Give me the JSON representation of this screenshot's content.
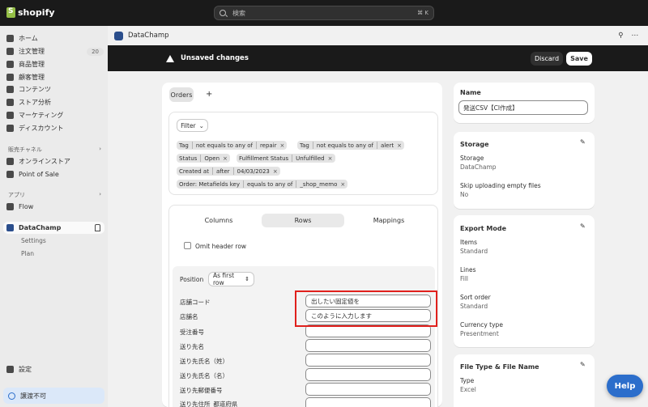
{
  "topbar": {
    "brand": "shopify",
    "search_placeholder": "検索",
    "search_shortcut": "⌘ K"
  },
  "sidebar": {
    "items": [
      {
        "label": "ホーム",
        "icon": "home-icon"
      },
      {
        "label": "注文管理",
        "icon": "orders-icon",
        "badge": "20"
      },
      {
        "label": "商品管理",
        "icon": "tag-icon"
      },
      {
        "label": "顧客管理",
        "icon": "person-icon"
      },
      {
        "label": "コンテンツ",
        "icon": "content-icon"
      },
      {
        "label": "ストア分析",
        "icon": "chart-icon"
      },
      {
        "label": "マーケティング",
        "icon": "target-icon"
      },
      {
        "label": "ディスカウント",
        "icon": "discount-icon"
      }
    ],
    "sales_channels_heading": "販売チャネル",
    "channels": [
      {
        "label": "オンラインストア",
        "icon": "store-icon"
      },
      {
        "label": "Point of Sale",
        "icon": "pos-icon"
      }
    ],
    "apps_heading": "アプリ",
    "apps": [
      {
        "label": "Flow",
        "icon": "flow-icon"
      }
    ],
    "active_app": "DataChamp",
    "sub_items": [
      "Settings",
      "Plan"
    ],
    "settings_label": "設定",
    "notice": "譲渡不可"
  },
  "appbar": {
    "title": "DataChamp"
  },
  "unsaved": {
    "message": "Unsaved changes",
    "discard": "Discard",
    "save": "Save"
  },
  "main": {
    "tab": "Orders",
    "add_tab": "+",
    "filter_label": "Filter",
    "chips": [
      [
        "Tag",
        "not equals to any of",
        "repair"
      ],
      [
        "Tag",
        "not equals to any of",
        "alert"
      ],
      [
        "Status",
        "Open"
      ],
      [
        "Fulfillment Status",
        "Unfulfilled"
      ],
      [
        "Created at",
        "after",
        "04/03/2023"
      ],
      [
        "Order: Metafields key",
        "equals to any of",
        "_shop_memo"
      ]
    ],
    "subtabs": [
      "Columns",
      "Rows",
      "Mappings"
    ],
    "omit_header": "Omit header row",
    "position_label": "Position",
    "position_value": "As first row",
    "fields": [
      {
        "label": "店舗コード",
        "value": "出したい固定値を"
      },
      {
        "label": "店舗名",
        "value": "このように入力します"
      },
      {
        "label": "受注番号",
        "value": ""
      },
      {
        "label": "送り先名",
        "value": ""
      },
      {
        "label": "送り先氏名（姓）",
        "value": ""
      },
      {
        "label": "送り先氏名（名）",
        "value": ""
      },
      {
        "label": "送り先郵便番号",
        "value": ""
      },
      {
        "label": "送り先住所_都道府県",
        "value": ""
      }
    ]
  },
  "right": {
    "name_title": "Name",
    "name_value": "発送CSV【CI作成】",
    "storage_title": "Storage",
    "storage_label": "Storage",
    "storage_value": "DataChamp",
    "skip_label": "Skip uploading empty files",
    "skip_value": "No",
    "export_title": "Export Mode",
    "items_label": "Items",
    "items_value": "Standard",
    "lines_label": "Lines",
    "lines_value": "Fill",
    "sort_label": "Sort order",
    "sort_value": "Standard",
    "currency_label": "Currency type",
    "currency_value": "Presentment",
    "filetype_title": "File Type & File Name",
    "type_label": "Type",
    "type_value": "Excel"
  },
  "help_label": "Help"
}
